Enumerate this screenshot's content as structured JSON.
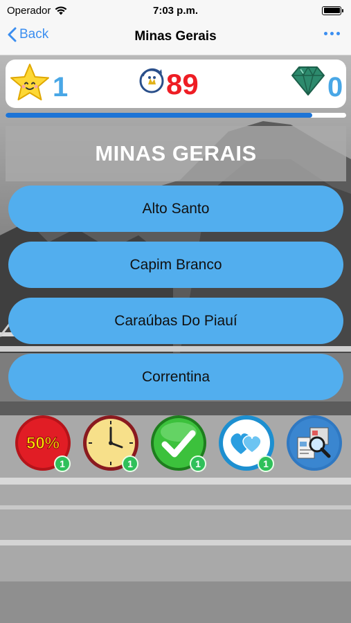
{
  "status_bar": {
    "carrier": "Operador",
    "time": "7:03 p.m."
  },
  "nav": {
    "back_label": "Back",
    "title": "Minas Gerais"
  },
  "score": {
    "stars": "1",
    "coins": "89",
    "gems": "0",
    "level_progress": 0.9
  },
  "question": {
    "title": "MINAS GERAIS"
  },
  "answers": [
    {
      "label": "Alto Santo"
    },
    {
      "label": "Capim Branco"
    },
    {
      "label": "Caraúbas Do Piauí"
    },
    {
      "label": "Correntina"
    }
  ],
  "lifelines": [
    {
      "icon": "fifty-percent-icon",
      "text": "50%",
      "count": "1"
    },
    {
      "icon": "clock-icon",
      "count": "1"
    },
    {
      "icon": "checkmark-icon",
      "count": "1"
    },
    {
      "icon": "hearts-icon",
      "count": "1"
    },
    {
      "icon": "search-document-icon"
    }
  ],
  "colors": {
    "accent_blue": "#3b8ef0",
    "answer_button": "#52aeee",
    "coins_red": "#ee1d24",
    "badge_green": "#2fc05a"
  }
}
